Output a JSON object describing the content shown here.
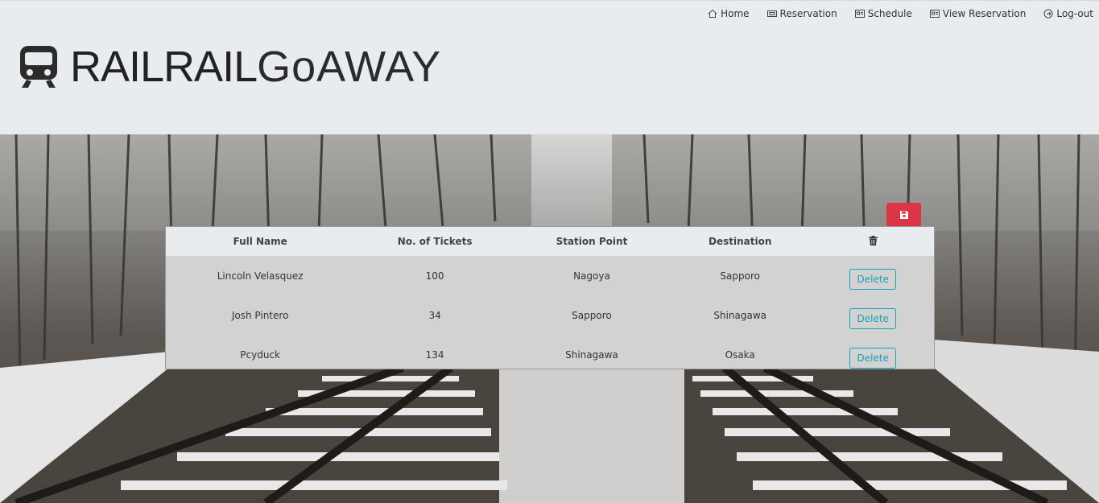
{
  "nav": [
    {
      "label": "Home",
      "icon": "home-icon"
    },
    {
      "label": "Reservation",
      "icon": "ticket-icon"
    },
    {
      "label": "Schedule",
      "icon": "calendar-icon"
    },
    {
      "label": "View Reservation",
      "icon": "id-card-icon"
    },
    {
      "label": "Log-out",
      "icon": "logout-icon"
    }
  ],
  "brand": {
    "bold": "RAILRAIL",
    "light": "GoAWAY",
    "logo_icon": "train-icon"
  },
  "table": {
    "headers": {
      "name": "Full Name",
      "tickets": "No. of Tickets",
      "station": "Station Point",
      "destination": "Destination",
      "action_icon": "trash-icon"
    },
    "rows": [
      {
        "name": "Lincoln Velasquez",
        "tickets": "100",
        "station": "Nagoya",
        "destination": "Sapporo",
        "action": "Delete"
      },
      {
        "name": "Josh Pintero",
        "tickets": "34",
        "station": "Sapporo",
        "destination": "Shinagawa",
        "action": "Delete"
      },
      {
        "name": "Pcyduck",
        "tickets": "134",
        "station": "Shinagawa",
        "destination": "Osaka",
        "action": "Delete"
      }
    ]
  },
  "save_button": {
    "icon": "save-icon",
    "color": "#dc3545"
  },
  "colors": {
    "header_bg": "#e9ecef",
    "delete_outline": "#17a2b8",
    "save": "#dc3545"
  }
}
